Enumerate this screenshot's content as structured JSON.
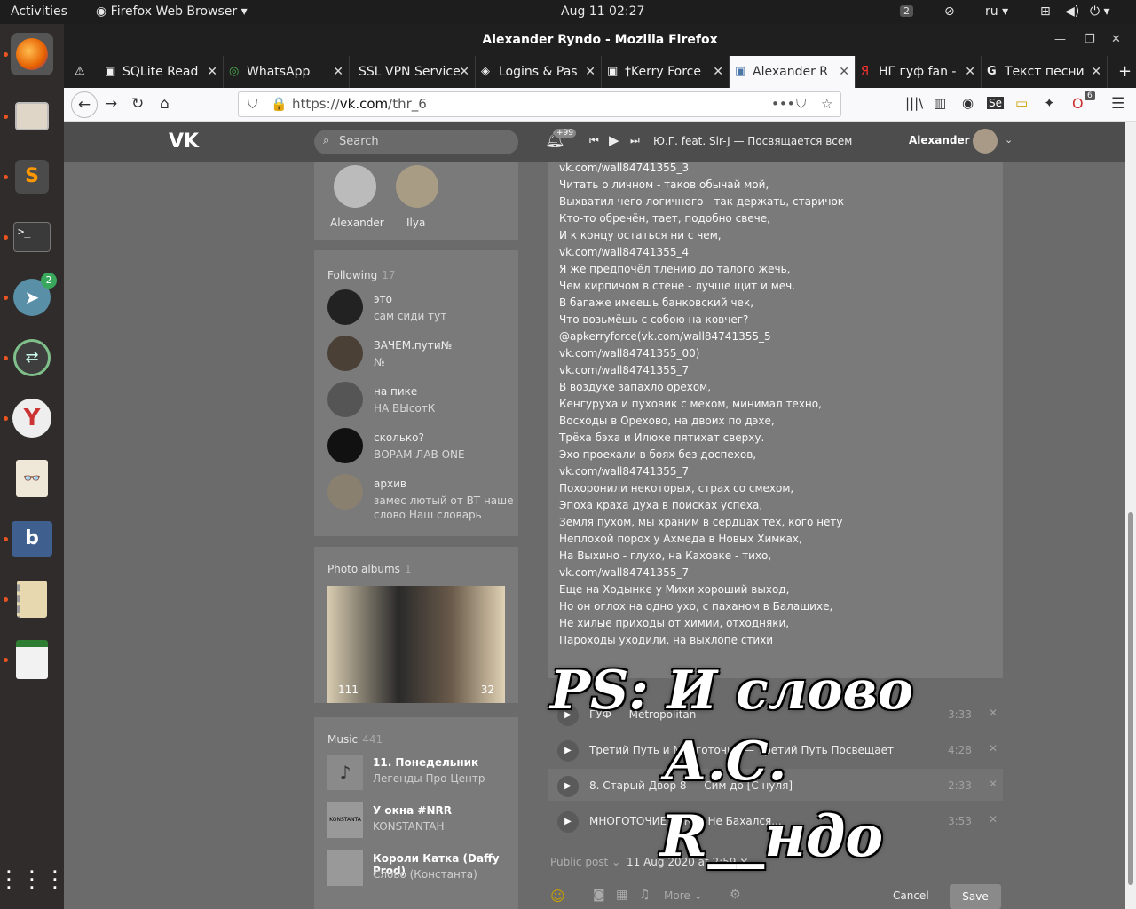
{
  "topbar": {
    "activities": "Activities",
    "app": "Firefox Web Browser",
    "clock": "Aug 11  02:27",
    "notif_badge": "2",
    "lang": "ru"
  },
  "dock": {
    "telegram_badge": "2"
  },
  "window": {
    "title": "Alexander Ryndo - Mozilla Firefox"
  },
  "tabs": [
    {
      "label": "SQLite Read"
    },
    {
      "label": "WhatsApp"
    },
    {
      "label": "SSL VPN Service"
    },
    {
      "label": "Logins & Pas"
    },
    {
      "label": "†Kerry Force"
    },
    {
      "label": "Alexander R"
    },
    {
      "label": "НГ гуф fan -"
    },
    {
      "label": "Текст песни"
    }
  ],
  "nav": {
    "url_prefix": "https://",
    "url_domain": "vk.com",
    "url_path": "/thr_6",
    "ext_badge": "6"
  },
  "vk": {
    "search_placeholder": "Search",
    "notif_count": "+99",
    "now_playing": "Ю.Г. feat. Sir-J — Посвящается всем",
    "user": "Alexander",
    "friends": [
      {
        "name": "Alexander"
      },
      {
        "name": "Ilya"
      }
    ],
    "following": {
      "label": "Following",
      "count": "17",
      "items": [
        {
          "name": "это",
          "sub": "сам сиди тут"
        },
        {
          "name": "ЗАЧЕМ.пути№",
          "sub": "№"
        },
        {
          "name": "на пике",
          "sub": "НА ВЫсотК"
        },
        {
          "name": "сколько?",
          "sub": "ВОРАМ ЛАВ ONE"
        },
        {
          "name": "архив",
          "sub": "замес лютый от ВТ наше",
          "sub2": "слово Наш словарь"
        }
      ]
    },
    "albums": {
      "label": "Photo albums",
      "count": "1",
      "photo_count": "111",
      "photo_count2": "32"
    },
    "music": {
      "label": "Music",
      "count": "441",
      "items": [
        {
          "title": "11. Понедельник",
          "artist": "Легенды Про Центр"
        },
        {
          "title": "У окна #NRR",
          "artist": "KONSTANTAH"
        },
        {
          "title": "Короли Катка (Daffy Prod)",
          "artist": "Слово (Константа)"
        }
      ]
    },
    "post_lines": [
      "vk.com/wall84741355_3",
      "Читать о личном - таков обычай мой,",
      "Выхватил чего логичного - так держать, старичок",
      "Кто-то обречён, тает, подобно свече,",
      "И к концу остаться ни с чем,",
      "vk.com/wall84741355_4",
      "Я же предпочёл тлению до талого жечь,",
      "Чем кирпичом в стене - лучше щит и меч.",
      "В багаже имеешь банковский чек,",
      "Что возьмёшь с собою на ковчег?",
      "@apkerryforce(vk.com/wall84741355_5",
      "vk.com/wall84741355_00)",
      "vk.com/wall84741355_7",
      "В воздухе запахло орехом,",
      "Кенгуруха и пуховик с мехом, минимал техно,",
      "Восходы в Орехово, на двоих по дэхе,",
      "Трёха бэха и Илюхе пятихат сверху.",
      "Эхо проехали в боях без доспехов,",
      "vk.com/wall84741355_7",
      "Похоронили некоторых, страх со смехом,",
      "Эпоха краха духа в поисках успеха,",
      "Земля пухом, мы храним в сердцах тех, кого нету",
      "Неплохой порох у Ахмеда в Новых Химках,",
      "На Выхино - глухо, на Каховке - тихо,",
      "vk.com/wall84741355_7",
      "Еще на Ходынке у Михи хороший выход,",
      "Но он оглох на одно ухо, с паханом в Балашихе,",
      "Не хилые приходы от химии, отходняки,",
      "Пароходы уходили, на выхлопе стихи"
    ],
    "tracks": [
      {
        "artist": "ГУФ",
        "title": "Metropolitan",
        "dur": "3:33"
      },
      {
        "artist": "Третий Путь и Многоточие",
        "title": "Третий Путь Посвещает",
        "dur": "4:28"
      },
      {
        "artist": "8. Старый Двор 8",
        "title": "Сим до [С нуля]",
        "dur": "2:33"
      },
      {
        "artist": "МНОГОТОЧИЕ",
        "title": "Кто Не Бахался...",
        "dur": "3:53"
      }
    ],
    "public_post": "Public post",
    "post_date": "11 Aug 2020 at 2:59",
    "more": "More",
    "cancel": "Cancel",
    "save": "Save"
  },
  "watermark": {
    "line1": "PS: И слово",
    "line2": "А.С.",
    "line3": "R__ндо"
  }
}
